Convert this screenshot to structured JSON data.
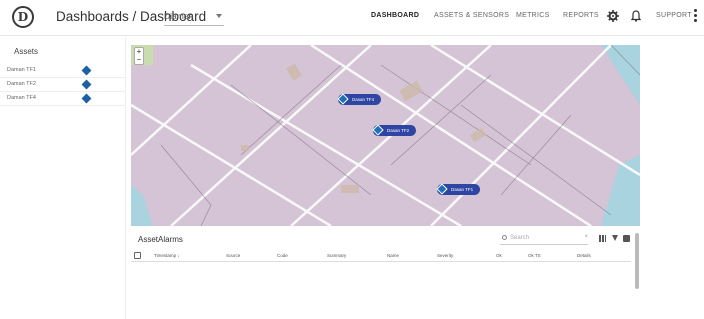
{
  "header": {
    "title": "Dashboards / Dashboard",
    "dashboard_select": "Diamen",
    "nav": [
      "DASHBOARD",
      "ASSETS & SENSORS",
      "METRICS",
      "REPORTS"
    ],
    "support": "SUPPORT"
  },
  "sidebar": {
    "title": "Assets",
    "items": [
      {
        "label": "Daman TF1"
      },
      {
        "label": "Daman TF2"
      },
      {
        "label": "Daman TF4"
      }
    ]
  },
  "map": {
    "zoom_in": "+",
    "zoom_out": "−",
    "pins": [
      "Dasan TF4",
      "Dasan TF2",
      "Dasan TF1"
    ]
  },
  "alarms": {
    "title": "AssetAlarms",
    "search_placeholder": "Search",
    "search_clear": "×",
    "columns": [
      "Timestamp ↓",
      "Source",
      "Code",
      "Summary",
      "Name",
      "Severity",
      "Ok",
      "Ok TS",
      "Details"
    ]
  },
  "colors": {
    "map_base": "#d4c4d6",
    "pin": "#2f45a4",
    "asset_marker": "#1f5fa6"
  }
}
